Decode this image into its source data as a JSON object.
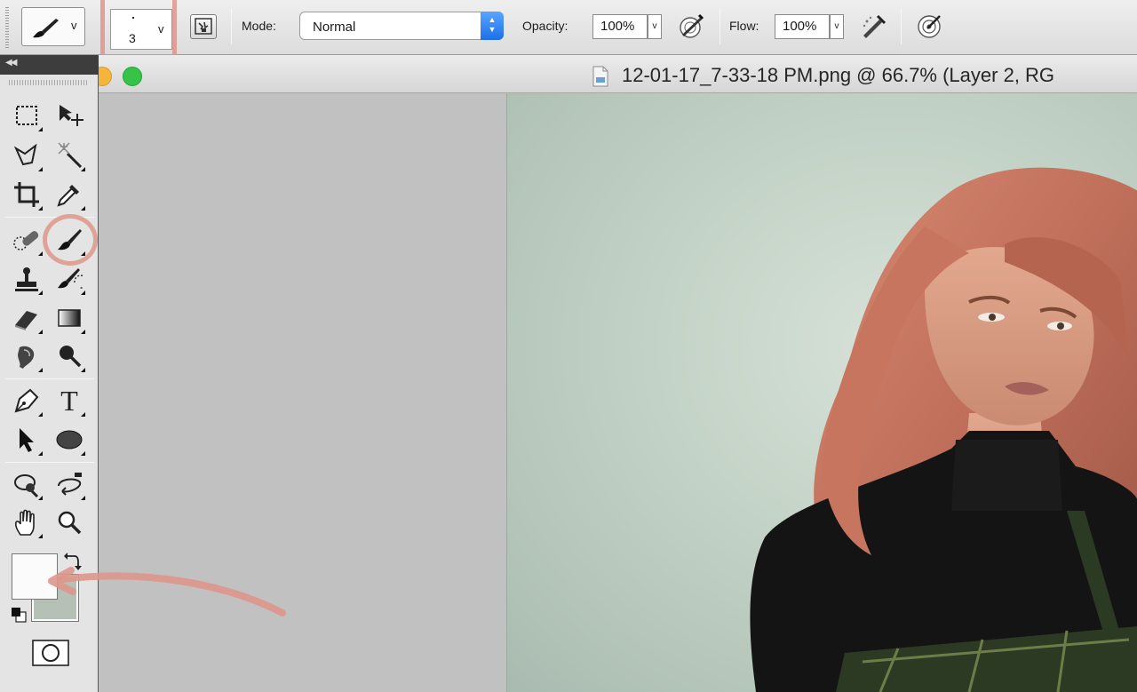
{
  "options_bar": {
    "brush_size": "3",
    "caret": "v",
    "mode_label": "Mode:",
    "mode_value": "Normal",
    "opacity_label": "Opacity:",
    "opacity_value": "100%",
    "flow_label": "Flow:",
    "flow_value": "100%"
  },
  "document": {
    "title": "12-01-17_7-33-18 PM.png @ 66.7% (Layer 2, RG"
  },
  "tools": {
    "text_tool_glyph": "T"
  },
  "colors": {
    "foreground": "#fbfbfb",
    "background": "#b5c1b6",
    "highlight": "#de968a"
  }
}
